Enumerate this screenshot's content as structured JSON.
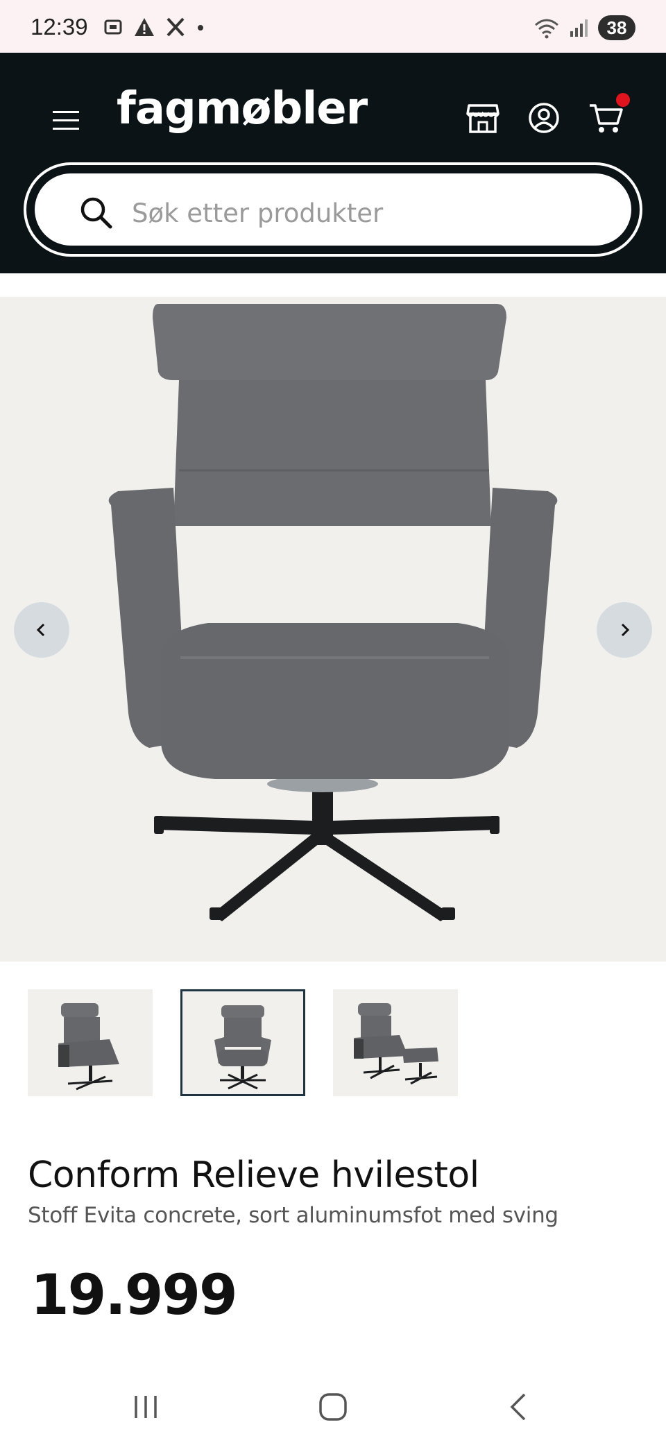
{
  "status_bar": {
    "time": "12:39",
    "battery": "38"
  },
  "header": {
    "brand": "fagmøbler",
    "search_placeholder": "Søk etter produkter",
    "cart_badge_color": "#e0141e"
  },
  "gallery": {
    "thumbnails": [
      "thumbnail-chair-side-view",
      "thumbnail-chair-front-view",
      "thumbnail-chair-with-footstool"
    ],
    "active_index": 1
  },
  "product": {
    "title": "Conform Relieve hvilestol",
    "subtitle": "Stoff Evita concrete, sort aluminumsfot med sving",
    "price": "19.999"
  },
  "icons": {
    "menu": "hamburger-menu-icon",
    "store": "store-icon",
    "account": "account-icon",
    "cart": "cart-icon",
    "search": "search-icon"
  }
}
